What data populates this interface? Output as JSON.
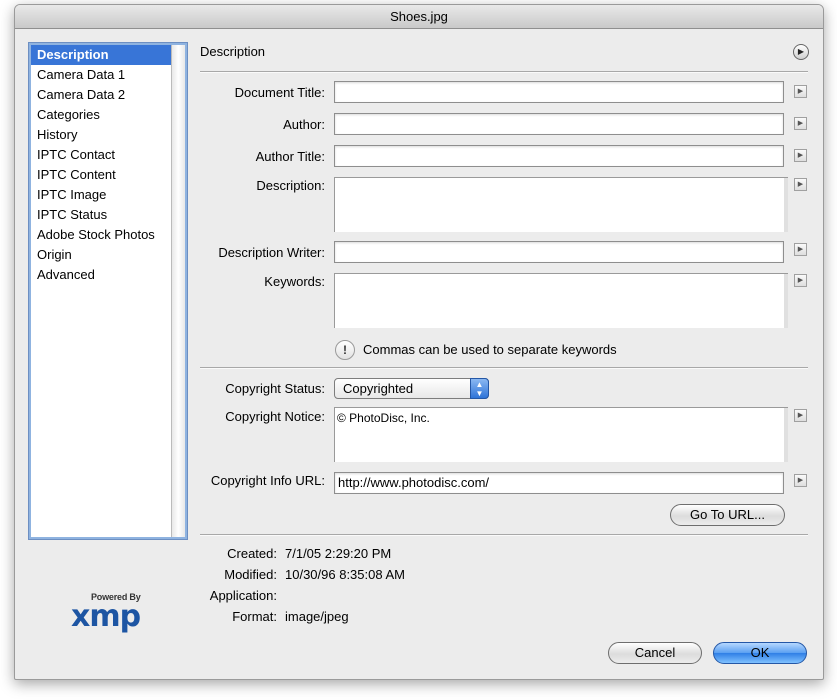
{
  "window": {
    "title": "Shoes.jpg"
  },
  "sidebar": {
    "items": [
      {
        "label": "Description",
        "selected": true
      },
      {
        "label": "Camera Data 1"
      },
      {
        "label": "Camera Data 2"
      },
      {
        "label": "Categories"
      },
      {
        "label": "History"
      },
      {
        "label": "IPTC Contact"
      },
      {
        "label": "IPTC Content"
      },
      {
        "label": "IPTC Image"
      },
      {
        "label": "IPTC Status"
      },
      {
        "label": "Adobe Stock Photos"
      },
      {
        "label": "Origin"
      },
      {
        "label": "Advanced"
      }
    ]
  },
  "panel": {
    "title": "Description",
    "menu_icon": "circle-play-icon"
  },
  "fields": {
    "document_title": {
      "label": "Document Title:",
      "value": ""
    },
    "author": {
      "label": "Author:",
      "value": ""
    },
    "author_title": {
      "label": "Author Title:",
      "value": ""
    },
    "description": {
      "label": "Description:",
      "value": ""
    },
    "description_writer": {
      "label": "Description Writer:",
      "value": ""
    },
    "keywords": {
      "label": "Keywords:",
      "value": ""
    },
    "keywords_hint": "Commas can be used to separate keywords",
    "copyright_status": {
      "label": "Copyright Status:",
      "value": "Copyrighted"
    },
    "copyright_notice": {
      "label": "Copyright Notice:",
      "value": "© PhotoDisc, Inc."
    },
    "copyright_url": {
      "label": "Copyright Info URL:",
      "value": "http://www.photodisc.com/"
    }
  },
  "buttons": {
    "go_to_url": "Go To URL...",
    "cancel": "Cancel",
    "ok": "OK"
  },
  "metadata": {
    "created": {
      "label": "Created:",
      "value": "7/1/05 2:29:20 PM"
    },
    "modified": {
      "label": "Modified:",
      "value": "10/30/96 8:35:08 AM"
    },
    "application": {
      "label": "Application:",
      "value": ""
    },
    "format": {
      "label": "Format:",
      "value": "image/jpeg"
    }
  },
  "branding": {
    "powered_by": "Powered By",
    "logo": "xmp"
  },
  "colors": {
    "selection": "#3875d7",
    "primary_button": "#2f7fe6",
    "logo": "#1d55a3"
  }
}
